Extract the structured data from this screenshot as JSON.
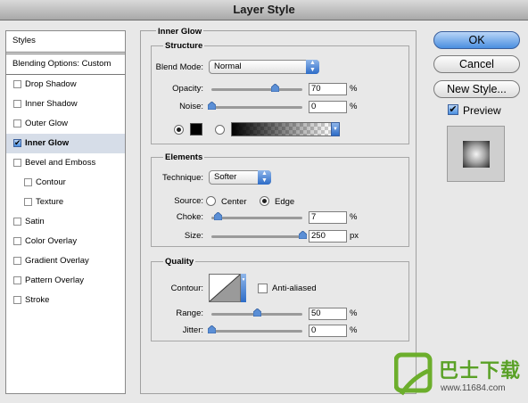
{
  "window": {
    "title": "Layer Style"
  },
  "sidebar": {
    "styles_header": "Styles",
    "blending_options": "Blending Options: Custom",
    "items": [
      {
        "label": "Drop Shadow",
        "checked": false,
        "indent": false
      },
      {
        "label": "Inner Shadow",
        "checked": false,
        "indent": false
      },
      {
        "label": "Outer Glow",
        "checked": false,
        "indent": false
      },
      {
        "label": "Inner Glow",
        "checked": true,
        "indent": false
      },
      {
        "label": "Bevel and Emboss",
        "checked": false,
        "indent": false
      },
      {
        "label": "Contour",
        "checked": false,
        "indent": true
      },
      {
        "label": "Texture",
        "checked": false,
        "indent": true
      },
      {
        "label": "Satin",
        "checked": false,
        "indent": false
      },
      {
        "label": "Color Overlay",
        "checked": false,
        "indent": false
      },
      {
        "label": "Gradient Overlay",
        "checked": false,
        "indent": false
      },
      {
        "label": "Pattern Overlay",
        "checked": false,
        "indent": false
      },
      {
        "label": "Stroke",
        "checked": false,
        "indent": false
      }
    ]
  },
  "panel": {
    "title": "Inner Glow",
    "structure": {
      "title": "Structure",
      "blend_mode_label": "Blend Mode:",
      "blend_mode_value": "Normal",
      "opacity_label": "Opacity:",
      "opacity_value": "70",
      "opacity_unit": "%",
      "opacity_level": 0.7,
      "noise_label": "Noise:",
      "noise_value": "0",
      "noise_unit": "%",
      "noise_level": 0.0,
      "color_mode": "solid",
      "color_swatch": "#000000"
    },
    "elements": {
      "title": "Elements",
      "technique_label": "Technique:",
      "technique_value": "Softer",
      "source_label": "Source:",
      "source_center": "Center",
      "source_edge": "Edge",
      "source_selected": "edge",
      "choke_label": "Choke:",
      "choke_value": "7",
      "choke_unit": "%",
      "choke_level": 0.07,
      "size_label": "Size:",
      "size_value": "250",
      "size_unit": "px",
      "size_level": 1.0
    },
    "quality": {
      "title": "Quality",
      "contour_label": "Contour:",
      "anti_aliased_label": "Anti-aliased",
      "anti_aliased_checked": false,
      "range_label": "Range:",
      "range_value": "50",
      "range_unit": "%",
      "range_level": 0.5,
      "jitter_label": "Jitter:",
      "jitter_value": "0",
      "jitter_unit": "%",
      "jitter_level": 0.0
    }
  },
  "buttons": {
    "ok": "OK",
    "cancel": "Cancel",
    "new_style": "New Style...",
    "preview_label": "Preview",
    "preview_checked": true
  },
  "watermark": {
    "brand": "巴士下载",
    "url": "www.11684.com"
  },
  "colors": {
    "accent_blue": "#2d6cc7",
    "selection": "#d6dde8"
  }
}
